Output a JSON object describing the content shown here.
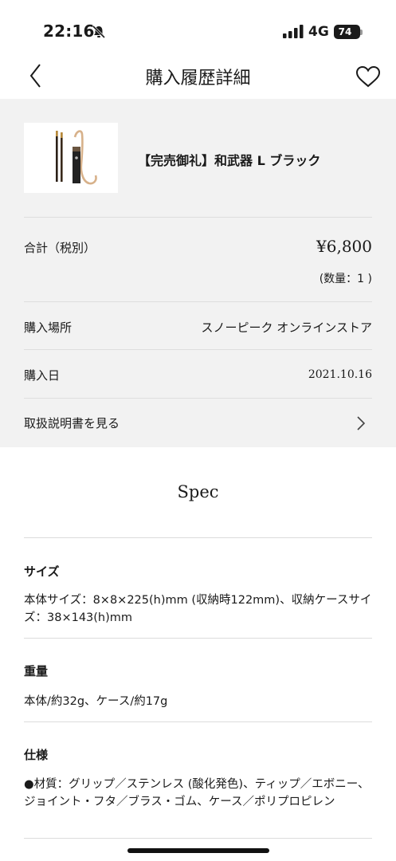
{
  "status_bar": {
    "time": "22:16",
    "network": "4G",
    "battery": "74"
  },
  "nav": {
    "title": "購入履歴詳細"
  },
  "product": {
    "name": "【完売御礼】和武器 L ブラック"
  },
  "rows": {
    "total_label": "合計（税別）",
    "total_price": "¥6,800",
    "quantity": "(数量：1 )",
    "place_label": "購入場所",
    "place_value": "スノーピーク オンラインストア",
    "date_label": "購入日",
    "date_value": "2021.10.16",
    "manual_label": "取扱説明書を見る"
  },
  "spec": {
    "title": "Spec",
    "sections": [
      {
        "heading": "サイズ",
        "body": "本体サイズ：8×8×225(h)mm (収納時122mm)、収納ケースサイズ：38×143(h)mm"
      },
      {
        "heading": "重量",
        "body": "本体/約32g、ケース/約17g"
      },
      {
        "heading": "仕様",
        "body": "●材質：グリップ／ステンレス (酸化発色)、ティップ／エボニー、ジョイント・フタ／ブラス・ゴム、ケース／ポリプロピレン"
      }
    ]
  }
}
